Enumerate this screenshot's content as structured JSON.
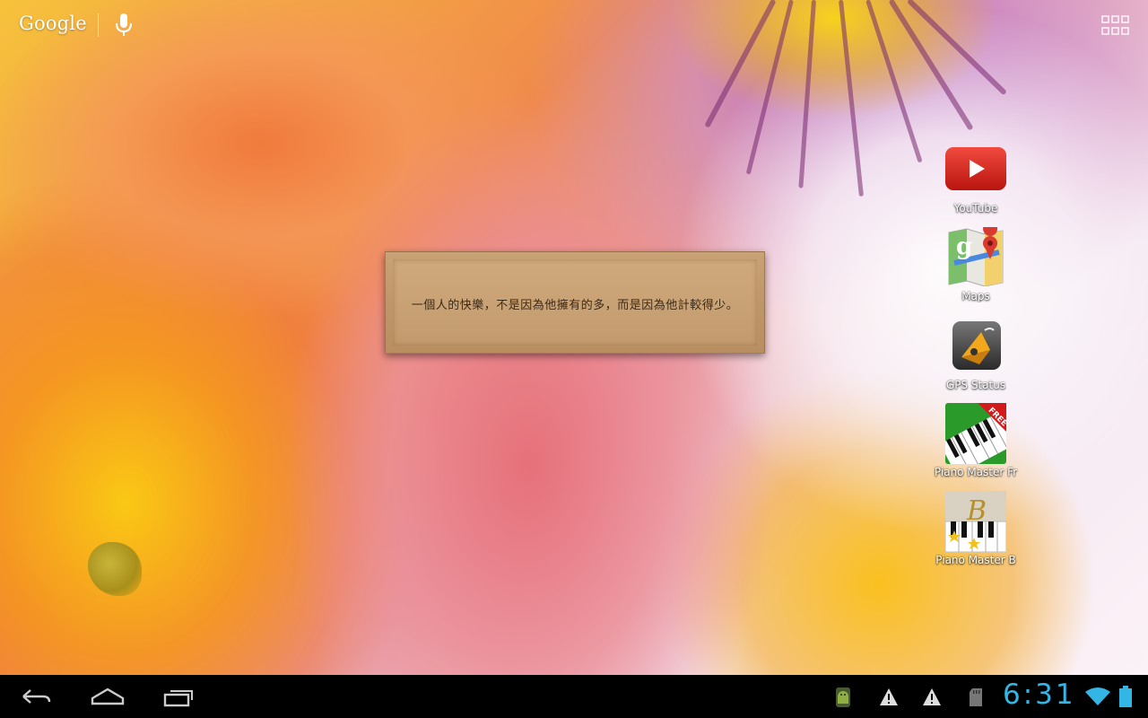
{
  "search": {
    "logo": "Google",
    "icon": "mic-icon"
  },
  "apps_button": {
    "icon": "all-apps-grid-icon"
  },
  "widget": {
    "quote": "一個人的快樂，不是因為他擁有的多，而是因為他計較得少。"
  },
  "shortcuts": [
    {
      "label": "YouTube",
      "icon": "youtube-icon"
    },
    {
      "label": "Maps",
      "icon": "maps-icon"
    },
    {
      "label": "GPS Status",
      "icon": "gps-status-icon"
    },
    {
      "label": "Piano Master Fr",
      "icon": "piano-master-free-icon",
      "badge": "FREE"
    },
    {
      "label": "Piano Master B",
      "icon": "piano-master-b-icon",
      "letter": "B"
    }
  ],
  "navbar": {
    "buttons": [
      "back-icon",
      "home-icon",
      "recent-apps-icon"
    ]
  },
  "status": {
    "icons": [
      "android-debug-icon",
      "warning-icon",
      "warning-icon",
      "sd-card-icon",
      "wifi-icon",
      "battery-icon"
    ],
    "time": "6:31",
    "accent_color": "#33b5e5"
  }
}
